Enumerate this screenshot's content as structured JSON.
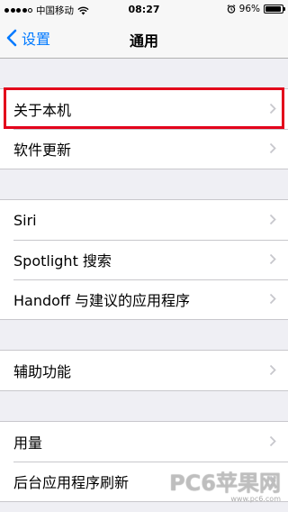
{
  "status_bar": {
    "carrier": "中国移动",
    "time": "08:27",
    "battery_percent_label": "96%",
    "battery_level": 0.96
  },
  "navbar": {
    "back_label": "设置",
    "title": "通用"
  },
  "groups": [
    {
      "rows": [
        "关于本机",
        "软件更新"
      ]
    },
    {
      "rows": [
        "Siri",
        "Spotlight 搜索",
        "Handoff 与建议的应用程序"
      ]
    },
    {
      "rows": [
        "辅助功能"
      ]
    },
    {
      "rows": [
        "用量",
        "后台应用程序刷新"
      ]
    }
  ],
  "watermark": {
    "logo": "PC6苹果网",
    "url": "www.pc6.com"
  },
  "colors": {
    "accent": "#007aff",
    "highlight": "#e3001b",
    "background": "#efeff4"
  }
}
